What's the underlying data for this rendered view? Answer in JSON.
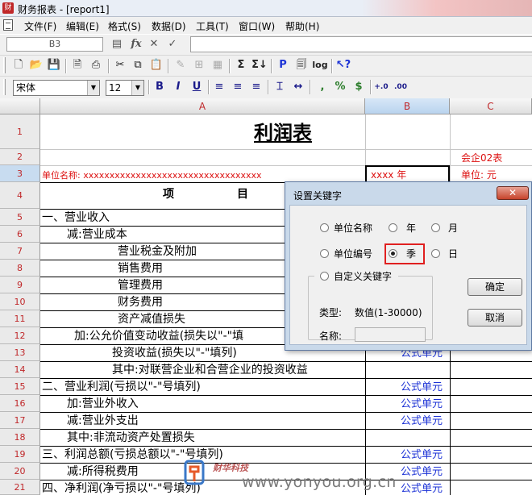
{
  "window": {
    "title": "财务报表 - [report1]",
    "app_icon_text": "财"
  },
  "menu": [
    "文件(F)",
    "编辑(E)",
    "格式(S)",
    "数据(D)",
    "工具(T)",
    "窗口(W)",
    "帮助(H)"
  ],
  "formula_bar": {
    "cell_ref": "B3",
    "fx": "fx",
    "cancel": "✕",
    "confirm": "✓",
    "value": ""
  },
  "toolbar1": [
    "new-icon",
    "open-icon",
    "save-icon",
    "print-preview-icon",
    "print-icon",
    "cut-icon",
    "copy-icon",
    "paste-icon",
    "format-painter-icon",
    "merge-icon",
    "sum-icon",
    "sum-sign-icon",
    "p-icon",
    "page-icon",
    "log-icon",
    "help-icon"
  ],
  "toolbar2": {
    "font_name": "宋体",
    "font_size": "12",
    "bold": "B",
    "italic": "I",
    "underline": "U",
    "percent": "%",
    "currency": "$",
    "comma": ","
  },
  "grid": {
    "columns": [
      "A",
      "B",
      "C"
    ],
    "rows": [
      "1",
      "2",
      "3",
      "4",
      "5",
      "6",
      "7",
      "8",
      "9",
      "10",
      "11",
      "12",
      "13",
      "14",
      "15",
      "16",
      "17",
      "18",
      "19",
      "20",
      "21"
    ],
    "title": "利润表",
    "code": "会企02表",
    "unit_name_label": "单位名称: xxxxxxxxxxxxxxxxxxxxxxxxxxxxxxxxxx",
    "year_cell": "xxxx 年",
    "unit_label": "单位: 元",
    "header_item": "项                目",
    "items": [
      "一、营业收入",
      "减:营业成本",
      "营业税金及附加",
      "销售费用",
      "管理费用",
      "财务费用",
      "资产减值损失",
      "加:公允价值变动收益(损失以\"-\"填",
      "投资收益(损失以\"-\"填列)",
      "其中:对联营企业和合营企业的投资收益",
      "二、营业利润(亏损以\"-\"号填列)",
      "加:营业外收入",
      "减:营业外支出",
      "其中:非流动资产处置损失",
      "三、利润总额(亏损总额以\"-\"号填列)",
      "减:所得税费用",
      "四、净利润(净亏损以\"-\"号填列)"
    ],
    "formula_cell": "公式单元"
  },
  "dialog": {
    "title": "设置关键字",
    "close": "✕",
    "options": {
      "unit_name": "单位名称",
      "year": "年",
      "month": "月",
      "unit_code": "单位编号",
      "quarter": "季",
      "day": "日",
      "custom": "自定义关键字"
    },
    "selected": "季",
    "type_label": "类型:",
    "type_value": "数值(1-30000)",
    "name_label": "名称:",
    "ok": "确定",
    "cancel": "取消"
  },
  "watermark": {
    "cn": "财华科技",
    "url": "www.yonyou.org.cn"
  },
  "colors": {
    "header_red": "#c0282a",
    "formula_blue": "#1d33d6",
    "selection_blue": "#c8dcf0",
    "highlight_red": "#e02020"
  }
}
